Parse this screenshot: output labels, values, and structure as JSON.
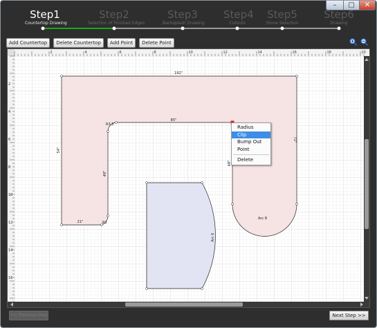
{
  "window": {
    "controls": {
      "minimize": "–",
      "maximize": "□",
      "close": "✕"
    }
  },
  "steps": [
    {
      "title": "Step1",
      "subtitle": "Countertop Drawing",
      "active": true
    },
    {
      "title": "Step2",
      "subtitle": "Selection of Finished Edges",
      "active": false
    },
    {
      "title": "Step3",
      "subtitle": "Backsplash Drawing",
      "active": false
    },
    {
      "title": "Step4",
      "subtitle": "Cutouts",
      "active": false
    },
    {
      "title": "Step5",
      "subtitle": "Stone Selection",
      "active": false
    },
    {
      "title": "Step6",
      "subtitle": "Drawing",
      "active": false
    }
  ],
  "toolbar": {
    "add_countertop": "Add Countertop",
    "delete_countertop": "Delete Countertop",
    "add_point": "Add Point",
    "delete_point": "Delete Point",
    "zoom_in_icon": "zoom-in-icon",
    "zoom_out_icon": "zoom-out-icon"
  },
  "ruler": {
    "top_labels": [
      "2",
      "4",
      "6",
      "8",
      "10",
      "12",
      "14",
      "16",
      "18",
      "20"
    ],
    "left_labels": [
      "2",
      "4",
      "6",
      "8",
      "10",
      "12",
      "14",
      "16",
      "18"
    ]
  },
  "drawing": {
    "labels": {
      "top_edge": "192\"",
      "right_edge": "72\"",
      "left_edge": "54\"",
      "inner_top": "85\"",
      "inner_left": "48\"",
      "inner_right": "48\"",
      "bottom_left": "21\"",
      "corner_radius_top": "R3.5",
      "corner_radius_bottom": "R3",
      "arc_right": "Arc 8",
      "arc_piece": "Arc 6"
    },
    "colors": {
      "countertop_fill": "#f6e3e3",
      "piece_fill": "#e3e4f3",
      "outline": "#222222",
      "selection": "#cc2222"
    }
  },
  "context_menu": {
    "items": [
      "Radius",
      "Clip",
      "Bump Out",
      "Point",
      "Delete"
    ],
    "selected": "Clip"
  },
  "footer": {
    "previous": "<< Previous Step",
    "next": "Next Step >>"
  }
}
